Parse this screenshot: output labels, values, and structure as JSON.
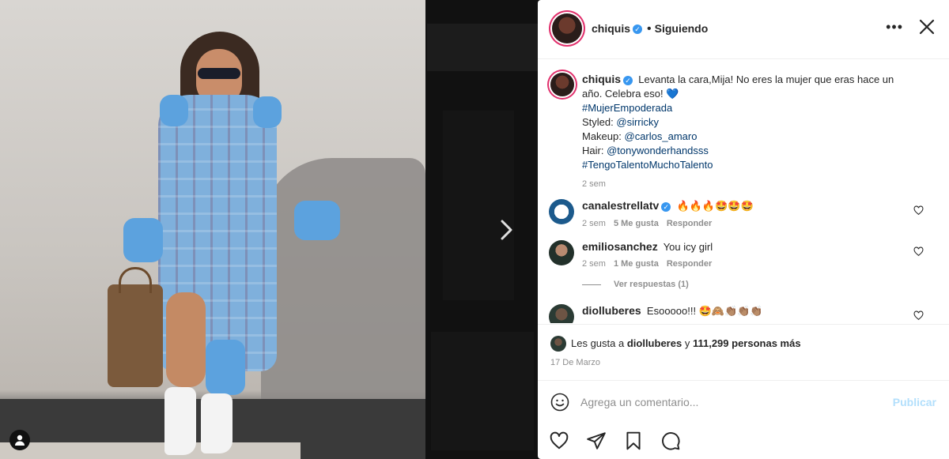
{
  "post": {
    "username": "chiquis",
    "verified": true,
    "follow_status": "Siguiendo",
    "more_label": "•••",
    "caption_lines": [
      "Levanta la cara,Mija! No eres la mujer que eras hace un",
      "año. Celebra eso! 💙"
    ],
    "caption_hashtag1": "#MujerEmpoderada",
    "caption_styled_label": "Styled:",
    "caption_styled_handle": "@sirricky",
    "caption_makeup_label": "Makeup:",
    "caption_makeup_handle": "@carlos_amaro",
    "caption_hair_label": "Hair:",
    "caption_hair_handle": "@tonywonderhandsss",
    "caption_hashtag2": "#TengoTalentoMuchoTalento",
    "caption_time": "2 sem"
  },
  "comments": [
    {
      "username": "canalestrellatv",
      "verified": true,
      "text": "🔥🔥🔥🤩🤩🤩",
      "time": "2 sem",
      "likes": "5 Me gusta",
      "reply": "Responder"
    },
    {
      "username": "emiliosanchez",
      "verified": false,
      "text": "You icy girl",
      "time": "2 sem",
      "likes": "1 Me gusta",
      "reply": "Responder"
    },
    {
      "username": "diolluberes",
      "verified": false,
      "text": "Esooooo!!! 🤩🙈👏🏽👏🏽👏🏽"
    }
  ],
  "view_replies": "Ver respuestas (1)",
  "likes": {
    "prefix": "Les gusta a",
    "user": "diolluberes",
    "joiner": "y",
    "count": "111,299 personas más"
  },
  "date": "17 De Marzo",
  "add_comment": {
    "placeholder": "Agrega un comentario...",
    "publish": "Publicar"
  },
  "icons": {
    "next": "chevron-right-icon",
    "close": "close-icon",
    "more": "more-options-icon",
    "like": "heart-icon",
    "share": "send-icon",
    "save": "bookmark-icon",
    "comment": "comment-icon",
    "emoji": "smiley-icon",
    "user_tag": "user-icon"
  },
  "colors": {
    "accent": "#3897f0",
    "link": "#00376b",
    "muted": "#8e8e8e",
    "publish_disabled": "#b2dffc"
  }
}
